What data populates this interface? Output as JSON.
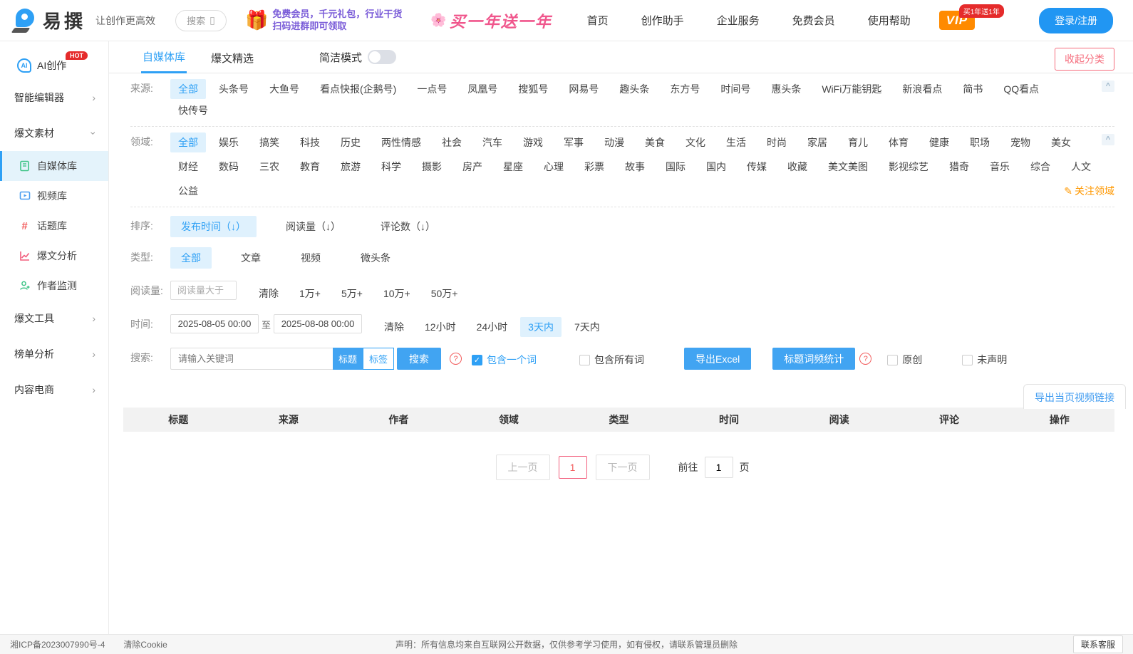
{
  "colors": {
    "accent_blue": "#2ea0f5",
    "chip_selected_bg": "#dff1fd",
    "button_blue": "#41a4f2",
    "pink_red": "#f56c7c",
    "vip_orange": "#ff8a00",
    "badge_red": "#e52b2b",
    "promo_purple": "#7a5cd8",
    "promo_pink": "#f0568c",
    "focus_orange": "#ff9800"
  },
  "header": {
    "logo_text": "易撰",
    "tagline": "让创作更高效",
    "search_label": "搜索",
    "search_icon": "▯",
    "promo1_line1": "免费会员，千元礼包，行业干货",
    "promo1_line2": "扫码进群即可领取",
    "promo2": "买一年送一年",
    "nav": [
      "首页",
      "创作助手",
      "企业服务",
      "免费会员",
      "使用帮助"
    ],
    "vip_label": "VIP",
    "vip_badge": "买1年送1年",
    "login_label": "登录/注册"
  },
  "sidebar": {
    "ai_creation": "AI创作",
    "hot_badge": "HOT",
    "smart_editor": "智能编辑器",
    "hot_material": "爆文素材",
    "media_library": "自媒体库",
    "video_library": "视频库",
    "topic_library": "话题库",
    "hot_analysis": "爆文分析",
    "author_monitor": "作者监测",
    "hot_tools": "爆文工具",
    "rank_analysis": "榜单分析",
    "content_ecommerce": "内容电商"
  },
  "main": {
    "tabs": {
      "tab1": "自媒体库",
      "tab2": "爆文精选"
    },
    "simple_mode_label": "简洁模式",
    "collapse_cats_label": "收起分类",
    "source": {
      "label": "来源:",
      "selected": "全部",
      "options": [
        "全部",
        "头条号",
        "大鱼号",
        "看点快报(企鹅号)",
        "一点号",
        "凤凰号",
        "搜狐号",
        "网易号",
        "趣头条",
        "东方号",
        "时间号",
        "惠头条",
        "WiFi万能钥匙",
        "新浪看点",
        "简书",
        "QQ看点",
        "快传号"
      ]
    },
    "domain": {
      "label": "领域:",
      "selected": "全部",
      "row1": [
        "全部",
        "娱乐",
        "搞笑",
        "科技",
        "历史",
        "两性情感",
        "社会",
        "汽车",
        "游戏",
        "军事",
        "动漫",
        "美食",
        "文化",
        "生活",
        "时尚",
        "家居",
        "育儿",
        "体育",
        "健康",
        "职场",
        "宠物",
        "美女"
      ],
      "row2": [
        "财经",
        "数码",
        "三农",
        "教育",
        "旅游",
        "科学",
        "摄影",
        "房产",
        "星座",
        "心理",
        "彩票",
        "故事",
        "国际",
        "国内",
        "传媒",
        "收藏",
        "美文美图",
        "影视综艺",
        "猎奇",
        "音乐",
        "综合",
        "人文"
      ],
      "row3": [
        "公益"
      ],
      "focus_label": "关注领域",
      "focus_icon": "✎"
    },
    "sort": {
      "label": "排序:",
      "selected": "发布时间（↓）",
      "options": [
        "发布时间（↓）",
        "阅读量（↓）",
        "评论数（↓）"
      ]
    },
    "type": {
      "label": "类型:",
      "selected": "全部",
      "options": [
        "全部",
        "文章",
        "视频",
        "微头条"
      ]
    },
    "readcount": {
      "label": "阅读量:",
      "placeholder": "阅读量大于",
      "options": [
        "清除",
        "1万+",
        "5万+",
        "10万+",
        "50万+"
      ]
    },
    "time": {
      "label": "时间:",
      "from_value": "2025-08-05 00:00",
      "to_label": "至",
      "to_value": "2025-08-08 00:00",
      "selected": "3天内",
      "options": [
        "清除",
        "12小时",
        "24小时",
        "3天内",
        "7天内"
      ]
    },
    "search": {
      "label": "搜索:",
      "placeholder": "请输入关键词",
      "scope_title": "标题",
      "scope_tag": "标签",
      "button": "搜索",
      "help_icon": "?",
      "cb_one_word": "包含一个词",
      "cb_all_words": "包含所有词",
      "export_excel": "导出Excel",
      "word_freq": "标题词频统计",
      "cb_original": "原创",
      "cb_undeclared": "未声明"
    },
    "export_video_label": "导出当页视频链接",
    "table_columns": [
      "标题",
      "来源",
      "作者",
      "领域",
      "类型",
      "时间",
      "阅读",
      "评论",
      "操作"
    ],
    "pagination": {
      "prev": "上一页",
      "current": "1",
      "next": "下一页",
      "goto_prefix": "前往",
      "goto_value": "1",
      "goto_suffix": "页"
    }
  },
  "footer": {
    "icp": "湘ICP备2023007990号-4",
    "clear_cookie": "清除Cookie",
    "statement": "声明：所有信息均来自互联网公开数据，仅供参考学习使用，如有侵权，请联系管理员删除",
    "contact": "联系客服"
  }
}
